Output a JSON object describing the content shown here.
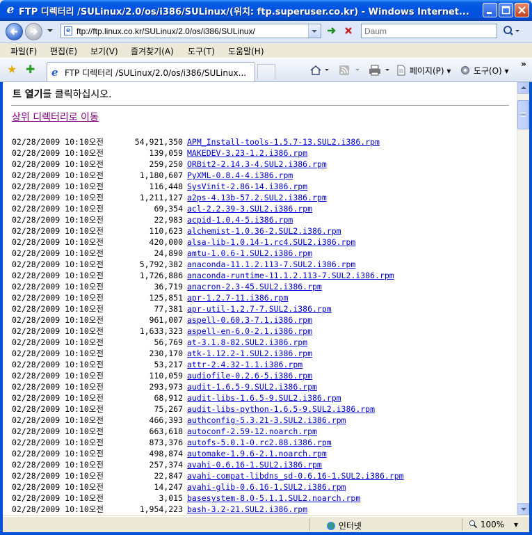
{
  "window": {
    "title": "FTP 디렉터리 /SULinux/2.0/os/i386/SULinux/(위치: ftp.superuser.co.kr) - Windows Internet..."
  },
  "address": {
    "url": "ftp://ftp.linux.co.kr/SULinux/2.0/os/i386/SULinux/",
    "search_placeholder": "Daum"
  },
  "menu": [
    "파일(F)",
    "편집(E)",
    "보기(V)",
    "즐겨찾기(A)",
    "도구(T)",
    "도움말(H)"
  ],
  "tab": {
    "title": "FTP 디렉터리 /SULinux/2.0/os/i386/SULinux..."
  },
  "commands": {
    "page": "페이지(P)",
    "tools": "도구(O)"
  },
  "content": {
    "intro_bold": "트 열기",
    "intro_rest": "를 클릭하십시오.",
    "up_link": "상위 디렉터리로 이동",
    "files": [
      {
        "date": "02/28/2009 10:10오전",
        "size": "54,921,350",
        "name": "APM_Install-tools-1.5.7-13.SUL2.i386.rpm"
      },
      {
        "date": "02/28/2009 10:10오전",
        "size": "139,059",
        "name": "MAKEDEV-3.23-1.2.i386.rpm"
      },
      {
        "date": "02/28/2009 10:10오전",
        "size": "259,250",
        "name": "ORBit2-2.14.3-4.SUL2.i386.rpm"
      },
      {
        "date": "02/28/2009 10:10오전",
        "size": "1,180,607",
        "name": "PyXML-0.8.4-4.i386.rpm"
      },
      {
        "date": "02/28/2009 10:10오전",
        "size": "116,448",
        "name": "SysVinit-2.86-14.i386.rpm"
      },
      {
        "date": "02/28/2009 10:10오전",
        "size": "1,211,127",
        "name": "a2ps-4.13b-57.2.SUL2.i386.rpm"
      },
      {
        "date": "02/28/2009 10:10오전",
        "size": "69,354",
        "name": "acl-2.2.39-3.SUL2.i386.rpm"
      },
      {
        "date": "02/28/2009 10:10오전",
        "size": "22,983",
        "name": "acpid-1.0.4-5.i386.rpm"
      },
      {
        "date": "02/28/2009 10:10오전",
        "size": "110,623",
        "name": "alchemist-1.0.36-2.SUL2.i386.rpm"
      },
      {
        "date": "02/28/2009 10:10오전",
        "size": "420,000",
        "name": "alsa-lib-1.0.14-1.rc4.SUL2.i386.rpm"
      },
      {
        "date": "02/28/2009 10:10오전",
        "size": "24,890",
        "name": "amtu-1.0.6-1.SUL2.i386.rpm"
      },
      {
        "date": "02/28/2009 10:10오전",
        "size": "5,792,382",
        "name": "anaconda-11.1.2.113-7.SUL2.i386.rpm"
      },
      {
        "date": "02/28/2009 10:10오전",
        "size": "1,726,886",
        "name": "anaconda-runtime-11.1.2.113-7.SUL2.i386.rpm"
      },
      {
        "date": "02/28/2009 10:10오전",
        "size": "36,719",
        "name": "anacron-2.3-45.SUL2.i386.rpm"
      },
      {
        "date": "02/28/2009 10:10오전",
        "size": "125,851",
        "name": "apr-1.2.7-11.i386.rpm"
      },
      {
        "date": "02/28/2009 10:10오전",
        "size": "77,381",
        "name": "apr-util-1.2.7-7.SUL2.i386.rpm"
      },
      {
        "date": "02/28/2009 10:10오전",
        "size": "961,007",
        "name": "aspell-0.60.3-7.1.i386.rpm"
      },
      {
        "date": "02/28/2009 10:10오전",
        "size": "1,633,323",
        "name": "aspell-en-6.0-2.1.i386.rpm"
      },
      {
        "date": "02/28/2009 10:10오전",
        "size": "56,769",
        "name": "at-3.1.8-82.SUL2.i386.rpm"
      },
      {
        "date": "02/28/2009 10:10오전",
        "size": "230,170",
        "name": "atk-1.12.2-1.SUL2.i386.rpm"
      },
      {
        "date": "02/28/2009 10:10오전",
        "size": "53,217",
        "name": "attr-2.4.32-1.1.i386.rpm"
      },
      {
        "date": "02/28/2009 10:10오전",
        "size": "110,059",
        "name": "audiofile-0.2.6-5.i386.rpm"
      },
      {
        "date": "02/28/2009 10:10오전",
        "size": "293,973",
        "name": "audit-1.6.5-9.SUL2.i386.rpm"
      },
      {
        "date": "02/28/2009 10:10오전",
        "size": "68,912",
        "name": "audit-libs-1.6.5-9.SUL2.i386.rpm"
      },
      {
        "date": "02/28/2009 10:10오전",
        "size": "75,267",
        "name": "audit-libs-python-1.6.5-9.SUL2.i386.rpm"
      },
      {
        "date": "02/28/2009 10:10오전",
        "size": "466,393",
        "name": "authconfig-5.3.21-3.SUL2.i386.rpm"
      },
      {
        "date": "02/28/2009 10:10오전",
        "size": "663,618",
        "name": "autoconf-2.59-12.noarch.rpm"
      },
      {
        "date": "02/28/2009 10:10오전",
        "size": "873,376",
        "name": "autofs-5.0.1-0.rc2.88.i386.rpm"
      },
      {
        "date": "02/28/2009 10:10오전",
        "size": "498,874",
        "name": "automake-1.9.6-2.1.noarch.rpm"
      },
      {
        "date": "02/28/2009 10:10오전",
        "size": "257,374",
        "name": "avahi-0.6.16-1.SUL2.i386.rpm"
      },
      {
        "date": "02/28/2009 10:10오전",
        "size": "22,847",
        "name": "avahi-compat-libdns_sd-0.6.16-1.SUL2.i386.rpm"
      },
      {
        "date": "02/28/2009 10:10오전",
        "size": "14,247",
        "name": "avahi-glib-0.6.16-1.SUL2.i386.rpm"
      },
      {
        "date": "02/28/2009 10:10오전",
        "size": "3,015",
        "name": "basesystem-8.0-5.1.1.SUL2.noarch.rpm"
      },
      {
        "date": "02/28/2009 10:10오전",
        "size": "1,954,223",
        "name": "bash-3.2-21.SUL2.i386.rpm"
      }
    ]
  },
  "status": {
    "zone": "인터넷",
    "zoom": "100%"
  }
}
